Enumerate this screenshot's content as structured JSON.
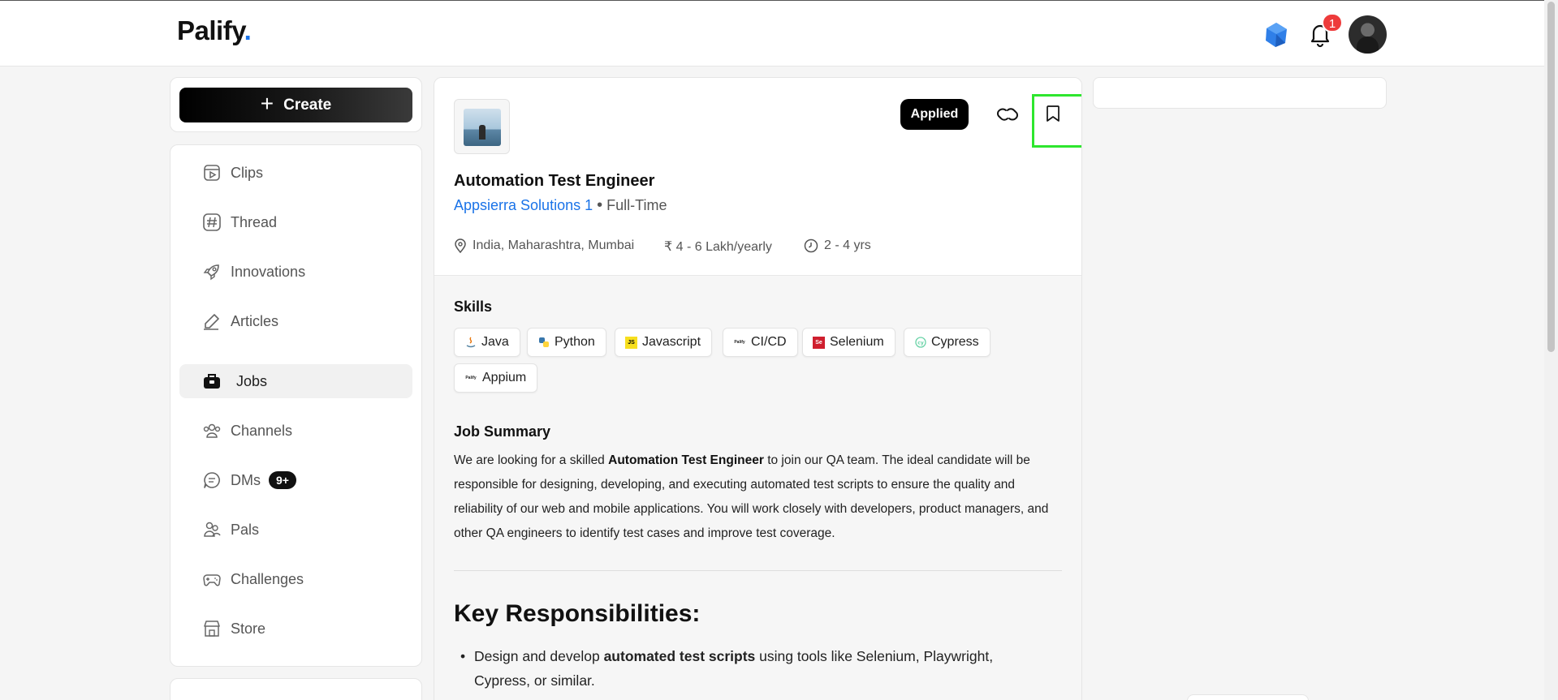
{
  "header": {
    "logo_text": "Palify",
    "logo_dot": ".",
    "notification_count": "1"
  },
  "create_button": {
    "label": "Create"
  },
  "sidebar": {
    "items": [
      {
        "label": "Clips",
        "icon": "clips-icon"
      },
      {
        "label": "Thread",
        "icon": "hashtag-icon"
      },
      {
        "label": "Innovations",
        "icon": "rocket-icon"
      },
      {
        "label": "Articles",
        "icon": "pencil-icon"
      },
      {
        "label": "Jobs",
        "icon": "briefcase-icon",
        "active": true
      },
      {
        "label": "Channels",
        "icon": "people-icon"
      },
      {
        "label": "DMs",
        "icon": "chat-icon",
        "badge": "9+"
      },
      {
        "label": "Pals",
        "icon": "pals-icon"
      },
      {
        "label": "Challenges",
        "icon": "gamepad-icon"
      },
      {
        "label": "Store",
        "icon": "store-icon"
      }
    ]
  },
  "job": {
    "status_label": "Applied",
    "title": "Automation Test Engineer",
    "company": "Appsierra Solutions 1",
    "separator": "•",
    "type": "Full-Time",
    "location": "India, Maharashtra, Mumbai",
    "salary": "₹ 4 - 6 Lakh/yearly",
    "experience": "2 - 4 yrs"
  },
  "skills": {
    "heading": "Skills",
    "items": [
      "Java",
      "Python",
      "Javascript",
      "CI/CD",
      "Selenium",
      "Cypress",
      "Appium"
    ]
  },
  "summary": {
    "heading": "Job Summary",
    "text_before": "We are looking for a skilled ",
    "text_bold": "Automation Test Engineer",
    "text_after": " to join our QA team. The ideal candidate will be responsible for designing, developing, and executing automated test scripts to ensure the quality and reliability of our web and mobile applications. You will work closely with developers, product managers, and other QA engineers to identify test cases and improve test coverage."
  },
  "responsibilities": {
    "heading": "Key Responsibilities:",
    "first_before": "Design and develop ",
    "first_bold": "automated test scripts",
    "first_after": " using tools like Selenium, Playwright, Cypress, or similar."
  },
  "colors": {
    "accent_blue": "#1a73e8",
    "highlight_green": "#2ee62e",
    "badge_red": "#ee3b3b"
  }
}
